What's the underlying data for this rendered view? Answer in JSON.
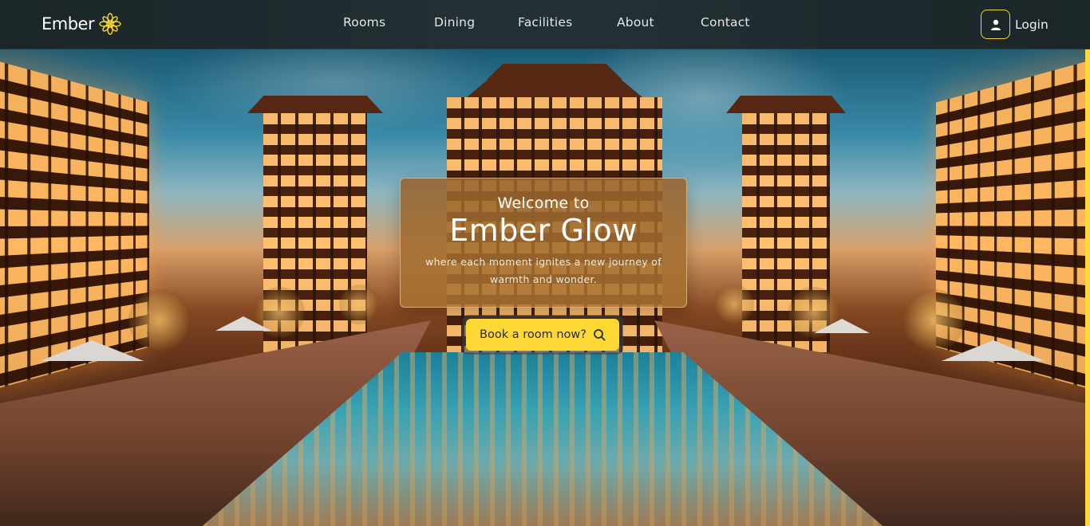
{
  "brand": {
    "name": "Ember",
    "logo_icon": "lotus-logo-icon",
    "accent": "#fdd835"
  },
  "nav": {
    "links": [
      {
        "label": "Rooms"
      },
      {
        "label": "Dining"
      },
      {
        "label": "Facilities"
      },
      {
        "label": "About"
      },
      {
        "label": "Contact"
      }
    ],
    "login": {
      "label": "Login",
      "icon": "user-icon"
    }
  },
  "hero": {
    "welcome_line": "Welcome to",
    "title": "Ember Glow",
    "tagline": "where each moment ignites a new journey of warmth and wonder.",
    "cta": {
      "label": "Book a room now?",
      "icon": "search-icon",
      "color": "#fdd835"
    }
  }
}
